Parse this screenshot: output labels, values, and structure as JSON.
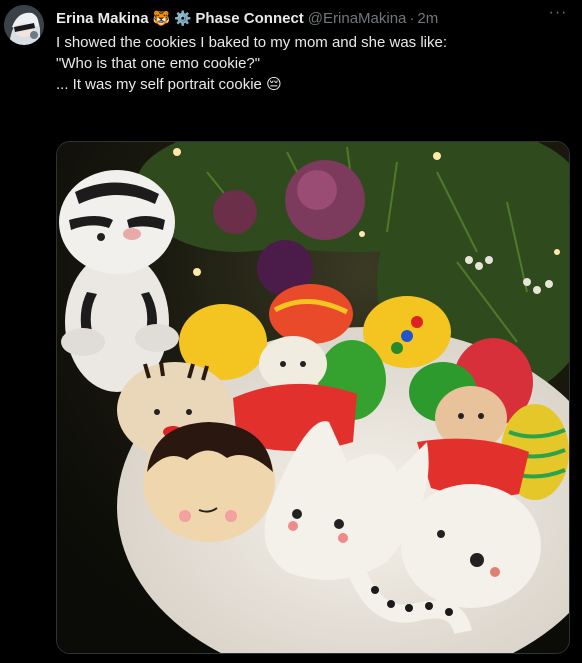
{
  "author": {
    "display_name": "Erina Makina",
    "badge_emoji": "🐯",
    "gear_emoji": "⚙️",
    "affiliation": "Phase Connect",
    "handle": "@ErinaMakina",
    "separator": "·",
    "time": "2m"
  },
  "post": {
    "lines": [
      "I showed the cookies I baked to my mom and she was like:",
      "\"Who is that one emo cookie?\"",
      "... It was my self portrait cookie 😔"
    ]
  },
  "more_menu": {
    "label": "···"
  },
  "icons": {
    "avatar": "user-avatar",
    "more": "more-options-icon"
  },
  "colors": {
    "background": "#000000",
    "text": "#e7e9ea",
    "secondary": "#71767b"
  }
}
